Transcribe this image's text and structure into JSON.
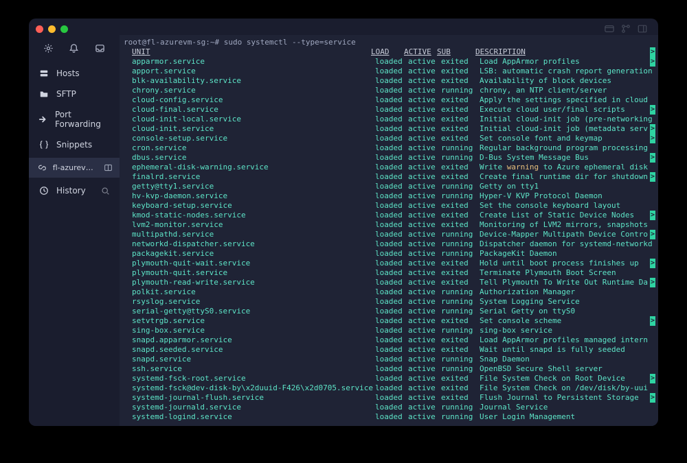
{
  "titlebar": {
    "icons": [
      "tabs",
      "branch",
      "panel"
    ]
  },
  "sidebar": {
    "top_icons": [
      "gear",
      "bell",
      "inbox"
    ],
    "items": [
      {
        "icon": "server",
        "label": "Hosts"
      },
      {
        "icon": "folder",
        "label": "SFTP"
      },
      {
        "icon": "forward",
        "label": "Port Forwarding"
      },
      {
        "icon": "bracket",
        "label": "Snippets"
      }
    ],
    "session": {
      "icon": "link",
      "label": "fl-azurevm…",
      "tail_icon": "split"
    },
    "history": {
      "icon": "clock",
      "label": "History",
      "search_icon": "search"
    }
  },
  "terminal": {
    "prompt": "root@fl-azurevm-sg:~#",
    "command": " sudo systemctl --type=service",
    "headers": {
      "unit": "UNIT",
      "load": "LOAD",
      "active": "ACTIVE",
      "sub": "SUB",
      "desc": "DESCRIPTION"
    },
    "truncation_markers": [
      1,
      6,
      8,
      9,
      11,
      13,
      17,
      19,
      22,
      24,
      28,
      34,
      36
    ],
    "services": [
      {
        "unit": "apparmor.service",
        "load": "loaded",
        "active": "active",
        "sub": "exited",
        "desc": "Load AppArmor profiles"
      },
      {
        "unit": "apport.service",
        "load": "loaded",
        "active": "active",
        "sub": "exited",
        "desc": "LSB: automatic crash report generation"
      },
      {
        "unit": "blk-availability.service",
        "load": "loaded",
        "active": "active",
        "sub": "exited",
        "desc": "Availability of block devices"
      },
      {
        "unit": "chrony.service",
        "load": "loaded",
        "active": "active",
        "sub": "running",
        "desc": "chrony, an NTP client/server"
      },
      {
        "unit": "cloud-config.service",
        "load": "loaded",
        "active": "active",
        "sub": "exited",
        "desc": "Apply the settings specified in cloud"
      },
      {
        "unit": "cloud-final.service",
        "load": "loaded",
        "active": "active",
        "sub": "exited",
        "desc": "Execute cloud user/final scripts"
      },
      {
        "unit": "cloud-init-local.service",
        "load": "loaded",
        "active": "active",
        "sub": "exited",
        "desc": "Initial cloud-init job (pre-networking"
      },
      {
        "unit": "cloud-init.service",
        "load": "loaded",
        "active": "active",
        "sub": "exited",
        "desc": "Initial cloud-init job (metadata serv"
      },
      {
        "unit": "console-setup.service",
        "load": "loaded",
        "active": "active",
        "sub": "exited",
        "desc": "Set console font and keymap"
      },
      {
        "unit": "cron.service",
        "load": "loaded",
        "active": "active",
        "sub": "running",
        "desc": "Regular background program processing"
      },
      {
        "unit": "dbus.service",
        "load": "loaded",
        "active": "active",
        "sub": "running",
        "desc": "D-Bus System Message Bus"
      },
      {
        "unit": "ephemeral-disk-warning.service",
        "load": "loaded",
        "active": "active",
        "sub": "exited",
        "desc": "Write |warning| to Azure ephemeral disk"
      },
      {
        "unit": "finalrd.service",
        "load": "loaded",
        "active": "active",
        "sub": "exited",
        "desc": "Create final runtime dir for shutdown"
      },
      {
        "unit": "getty@tty1.service",
        "load": "loaded",
        "active": "active",
        "sub": "running",
        "desc": "Getty on tty1"
      },
      {
        "unit": "hv-kvp-daemon.service",
        "load": "loaded",
        "active": "active",
        "sub": "running",
        "desc": "Hyper-V KVP Protocol Daemon"
      },
      {
        "unit": "keyboard-setup.service",
        "load": "loaded",
        "active": "active",
        "sub": "exited",
        "desc": "Set the console keyboard layout"
      },
      {
        "unit": "kmod-static-nodes.service",
        "load": "loaded",
        "active": "active",
        "sub": "exited",
        "desc": "Create List of Static Device Nodes"
      },
      {
        "unit": "lvm2-monitor.service",
        "load": "loaded",
        "active": "active",
        "sub": "exited",
        "desc": "Monitoring of LVM2 mirrors, snapshots"
      },
      {
        "unit": "multipathd.service",
        "load": "loaded",
        "active": "active",
        "sub": "running",
        "desc": "Device-Mapper Multipath Device Contro"
      },
      {
        "unit": "networkd-dispatcher.service",
        "load": "loaded",
        "active": "active",
        "sub": "running",
        "desc": "Dispatcher daemon for systemd-networkd"
      },
      {
        "unit": "packagekit.service",
        "load": "loaded",
        "active": "active",
        "sub": "running",
        "desc": "PackageKit Daemon"
      },
      {
        "unit": "plymouth-quit-wait.service",
        "load": "loaded",
        "active": "active",
        "sub": "exited",
        "desc": "Hold until boot process finishes up"
      },
      {
        "unit": "plymouth-quit.service",
        "load": "loaded",
        "active": "active",
        "sub": "exited",
        "desc": "Terminate Plymouth Boot Screen"
      },
      {
        "unit": "plymouth-read-write.service",
        "load": "loaded",
        "active": "active",
        "sub": "exited",
        "desc": "Tell Plymouth To Write Out Runtime Da"
      },
      {
        "unit": "polkit.service",
        "load": "loaded",
        "active": "active",
        "sub": "running",
        "desc": "Authorization Manager"
      },
      {
        "unit": "rsyslog.service",
        "load": "loaded",
        "active": "active",
        "sub": "running",
        "desc": "System Logging Service"
      },
      {
        "unit": "serial-getty@ttyS0.service",
        "load": "loaded",
        "active": "active",
        "sub": "running",
        "desc": "Serial Getty on ttyS0"
      },
      {
        "unit": "setvtrgb.service",
        "load": "loaded",
        "active": "active",
        "sub": "exited",
        "desc": "Set console scheme"
      },
      {
        "unit": "sing-box.service",
        "load": "loaded",
        "active": "active",
        "sub": "running",
        "desc": "sing-box service"
      },
      {
        "unit": "snapd.apparmor.service",
        "load": "loaded",
        "active": "active",
        "sub": "exited",
        "desc": "Load AppArmor profiles managed intern"
      },
      {
        "unit": "snapd.seeded.service",
        "load": "loaded",
        "active": "active",
        "sub": "exited",
        "desc": "Wait until snapd is fully seeded"
      },
      {
        "unit": "snapd.service",
        "load": "loaded",
        "active": "active",
        "sub": "running",
        "desc": "Snap Daemon"
      },
      {
        "unit": "ssh.service",
        "load": "loaded",
        "active": "active",
        "sub": "running",
        "desc": "OpenBSD Secure Shell server"
      },
      {
        "unit": "systemd-fsck-root.service",
        "load": "loaded",
        "active": "active",
        "sub": "exited",
        "desc": "File System Check on Root Device"
      },
      {
        "unit": "systemd-fsck@dev-disk-by\\x2duuid-F426\\x2d0705.service",
        "load": "loaded",
        "active": "active",
        "sub": "exited",
        "desc": "File System Check on /dev/disk/by-uui"
      },
      {
        "unit": "systemd-journal-flush.service",
        "load": "loaded",
        "active": "active",
        "sub": "exited",
        "desc": "Flush Journal to Persistent Storage"
      },
      {
        "unit": "systemd-journald.service",
        "load": "loaded",
        "active": "active",
        "sub": "running",
        "desc": "Journal Service"
      },
      {
        "unit": "systemd-logind.service",
        "load": "loaded",
        "active": "active",
        "sub": "running",
        "desc": "User Login Management"
      }
    ]
  },
  "colors": {
    "accent": "#5de4c7",
    "warning": "#e8c07d",
    "bg": "#1f2335",
    "panel": "#1a1d2e"
  }
}
